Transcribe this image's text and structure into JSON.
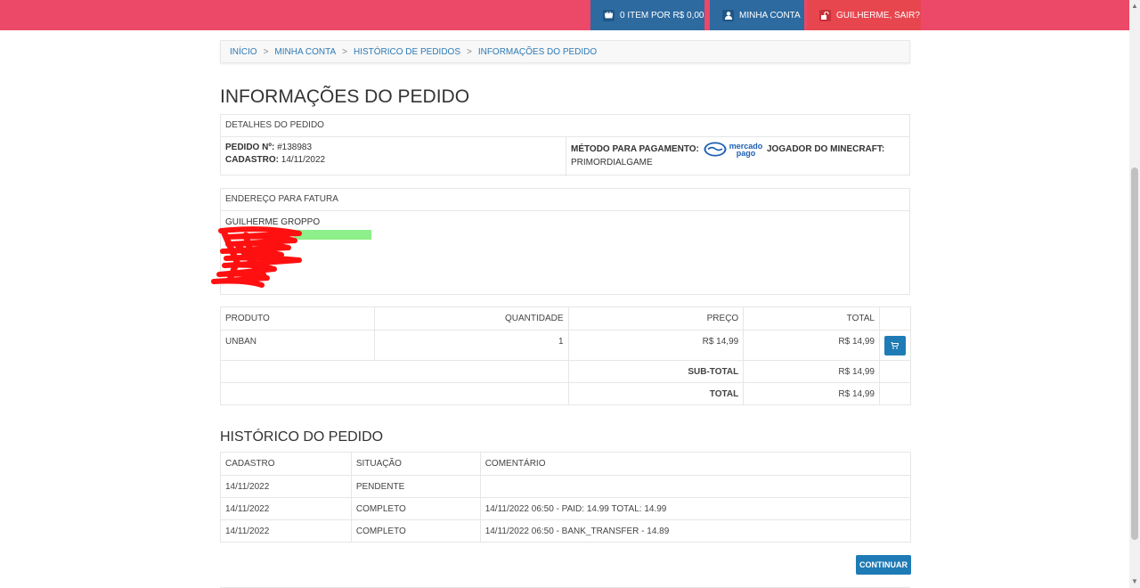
{
  "header": {
    "cart_label": "0 ITEM POR R$ 0,00",
    "account_label": "MINHA CONTA",
    "logout_label": "GUILHERME, SAIR?"
  },
  "breadcrumb": {
    "items": [
      "INÍCIO",
      "MINHA CONTA",
      "HISTÓRICO DE PEDIDOS",
      "INFORMAÇÕES DO PEDIDO"
    ],
    "separator": ">"
  },
  "page_title": "INFORMAÇÕES DO PEDIDO",
  "details": {
    "heading": "DETALHES DO PEDIDO",
    "order_label": "PEDIDO Nº:",
    "order_value": "#138983",
    "date_label": "CADASTRO:",
    "date_value": "14/11/2022",
    "payment_label": "MÉTODO PARA PAGAMENTO:",
    "payment_logo_line1": "mercado",
    "payment_logo_line2": "pago",
    "player_label": "JOGADOR DO MINECRAFT:",
    "player_value": "PRIMORDIALGAME"
  },
  "address": {
    "heading": "ENDEREÇO PARA FATURA",
    "name": "GUILHERME GROPPO"
  },
  "products": {
    "headers": [
      "PRODUTO",
      "QUANTIDADE",
      "PREÇO",
      "TOTAL"
    ],
    "rows": [
      {
        "product": "UNBAN",
        "qty": "1",
        "price": "R$ 14,99",
        "total": "R$ 14,99"
      }
    ],
    "subtotal_label": "SUB-TOTAL",
    "subtotal_value": "R$ 14,99",
    "total_label": "TOTAL",
    "total_value": "R$ 14,99"
  },
  "history": {
    "title": "HISTÓRICO DO PEDIDO",
    "headers": [
      "CADASTRO",
      "SITUAÇÃO",
      "COMENTÁRIO"
    ],
    "rows": [
      {
        "date": "14/11/2022",
        "status": "PENDENTE",
        "comment": ""
      },
      {
        "date": "14/11/2022",
        "status": "COMPLETO",
        "comment": "14/11/2022 06:50 - PAID: 14.99 TOTAL: 14.99"
      },
      {
        "date": "14/11/2022",
        "status": "COMPLETO",
        "comment": "14/11/2022 06:50 - BANK_TRANSFER - 14.89"
      }
    ]
  },
  "continue_label": "CONTINUAR",
  "colors": {
    "topbar": "#ec4868",
    "account_blue": "#2d6aa0",
    "logout_red": "#e8464f",
    "link_blue": "#2d7ab5",
    "button_blue": "#1f7bb5"
  },
  "icons": {
    "cart": "basket-icon",
    "account": "user-icon",
    "logout": "unlock-icon",
    "row_action": "cart-icon"
  }
}
